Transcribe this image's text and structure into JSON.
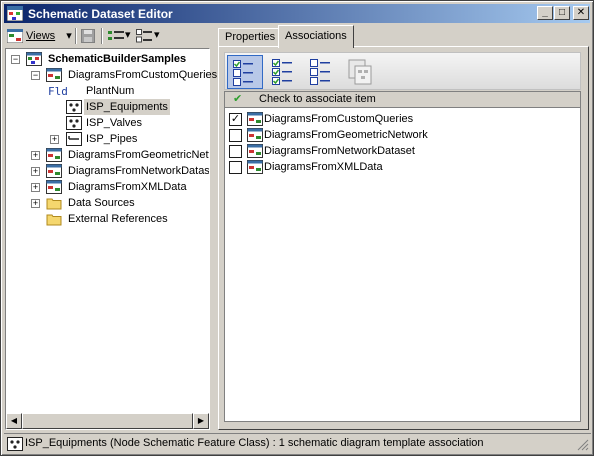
{
  "window": {
    "title": "Schematic Dataset Editor",
    "minimize_glyph": "_",
    "maximize_glyph": "□",
    "close_glyph": "✕"
  },
  "toolbar": {
    "views_label": "Views",
    "dropdown_glyph": "▾"
  },
  "tree": {
    "root": "SchematicBuilderSamples",
    "items": [
      {
        "label": "DiagramsFromCustomQueries",
        "icon": "schematic-template-icon",
        "expander": "−"
      },
      {
        "label": "PlantNum",
        "icon": "field-icon",
        "icon_text": "Fld"
      },
      {
        "label": "ISP_Equipments",
        "icon": "node-feature-class-icon",
        "selected": true
      },
      {
        "label": "ISP_Valves",
        "icon": "node-feature-class-icon"
      },
      {
        "label": "ISP_Pipes",
        "icon": "link-feature-class-icon",
        "expander": "+"
      },
      {
        "label": "DiagramsFromGeometricNetwork",
        "icon": "schematic-template-icon",
        "expander": "+"
      },
      {
        "label": "DiagramsFromNetworkDataset",
        "icon": "schematic-template-icon",
        "expander": "+"
      },
      {
        "label": "DiagramsFromXMLData",
        "icon": "schematic-template-icon",
        "expander": "+"
      },
      {
        "label": "Data Sources",
        "icon": "folder-icon",
        "expander": "+"
      },
      {
        "label": "External References",
        "icon": "folder-icon"
      }
    ],
    "root_expander": "−"
  },
  "scrollbar": {
    "left_arrow": "◀",
    "right_arrow": "▶"
  },
  "tabs": [
    {
      "label": "Properties",
      "active": false
    },
    {
      "label": "Associations",
      "active": true
    }
  ],
  "associations": {
    "header": "Check to associate item",
    "header_check": "✔",
    "items": [
      {
        "label": "DiagramsFromCustomQueries",
        "checked": true
      },
      {
        "label": "DiagramsFromGeometricNetwork",
        "checked": false
      },
      {
        "label": "DiagramsFromNetworkDataset",
        "checked": false
      },
      {
        "label": "DiagramsFromXMLData",
        "checked": false
      }
    ]
  },
  "status": {
    "text": "ISP_Equipments (Node Schematic Feature Class) : 1 schematic diagram template association"
  },
  "colors": {
    "title_start": "#0a246a",
    "title_end": "#a6caf0",
    "check_green": "#2e9e2e",
    "selection_gray": "#d4d0c8"
  }
}
